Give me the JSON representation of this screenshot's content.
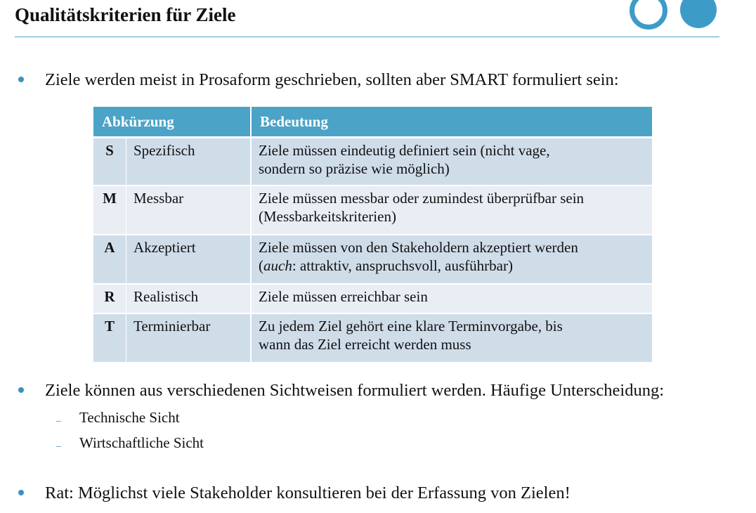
{
  "slide": {
    "title": "Qualitätskriterien für Ziele"
  },
  "bullets": [
    "Ziele werden meist in Prosaform geschrieben, sollten aber SMART formuliert sein:",
    "Ziele können aus verschiedenen Sichtweisen formuliert werden. Häufige Unterscheidung:",
    "Rat: Möglichst viele Stakeholder konsultieren bei der Erfassung von Zielen!"
  ],
  "sub_bullets": [
    "Technische Sicht",
    "Wirtschaftliche Sicht"
  ],
  "table": {
    "headers": [
      "Abkürzung",
      "Bedeutung"
    ],
    "rows": [
      {
        "letter": "S",
        "term": "Spezifisch",
        "desc_a": "Ziele müssen eindeutig definiert sein (nicht vage,",
        "desc_b": "sondern so präzise wie möglich)"
      },
      {
        "letter": "M",
        "term": "Messbar",
        "desc_a": "Ziele müssen messbar oder zumindest überprüfbar sein",
        "desc_b": "(Messbarkeitskriterien)"
      },
      {
        "letter": "A",
        "term": "Akzeptiert",
        "desc_a": "Ziele müssen von den Stakeholdern akzeptiert werden",
        "desc_b_italic": "auch",
        "desc_b_rest": ": attraktiv, anspruchsvoll, ausführbar)"
      },
      {
        "letter": "R",
        "term": "Realistisch",
        "desc_a": "Ziele müssen erreichbar sein"
      },
      {
        "letter": "T",
        "term": "Terminierbar",
        "desc_a": "Zu jedem Ziel gehört eine klare Terminvorgabe, bis",
        "desc_b": "wann das Ziel erreicht werden muss"
      }
    ]
  },
  "colors": {
    "accent": "#4ba3c7",
    "row_dark": "#cfdde9",
    "row_light": "#e9eef4"
  }
}
